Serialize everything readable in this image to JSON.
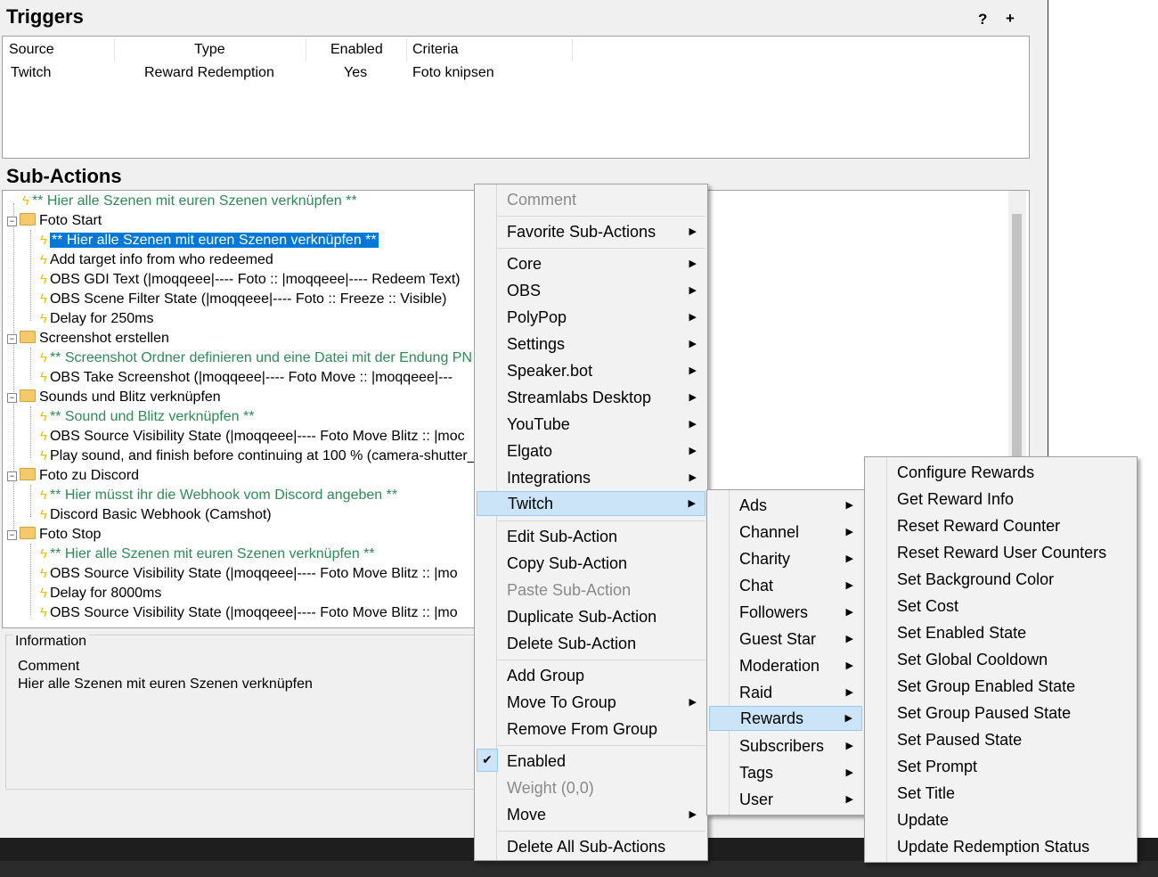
{
  "triggers": {
    "title": "Triggers",
    "help_icon": "?",
    "add_icon": "+",
    "columns": [
      "Source",
      "Type",
      "Enabled",
      "Criteria"
    ],
    "rows": [
      {
        "source": "Twitch",
        "type": "Reward Redemption",
        "enabled": "Yes",
        "criteria": "Foto knipsen"
      }
    ]
  },
  "subactions": {
    "title": "Sub-Actions",
    "items": [
      "** Hier alle Szenen mit euren Szenen verknüpfen **",
      "Foto Start",
      "** Hier alle Szenen mit euren Szenen verknüpfen **",
      "Add target info from who redeemed",
      "OBS GDI Text (‬|moqqeee|---- Foto :: |moqqeee|---- Redeem Text)",
      "OBS Scene Filter State (‬|moqqeee|---- Foto :: Freeze :: Visible)",
      "Delay for 250ms",
      "Screenshot erstellen",
      "** Screenshot Ordner definieren und eine Datei mit der Endung PN",
      "OBS Take Screenshot (‬|moqqeee|---- Foto Move :: ‬|moqqeee|---",
      "Sounds und Blitz verknüpfen",
      "** Sound und Blitz verknüpfen **",
      "OBS Source Visibility State (‬|moqqeee|---- Foto Move Blitz :: |moc",
      "Play sound, and finish before continuing at 100 % (camera-shutter_",
      "Foto zu Discord",
      "** Hier müsst ihr die Webhook vom Discord angeben **",
      "Discord Basic Webhook (Camshot)",
      "Foto Stop",
      "** Hier alle Szenen mit euren Szenen verknüpfen **",
      "OBS Source Visibility State (‬|moqqeee|---- Foto Move Blitz :: ‬|mo",
      "Delay for 8000ms",
      "OBS Source Visibility State (‬|moqqeee|---- Foto Move Blitz :: ‬|mo"
    ]
  },
  "information": {
    "legend": "Information",
    "label": "Comment",
    "value": "Hier alle Szenen mit euren Szenen verknüpfen"
  },
  "context_menu": {
    "comment": "Comment",
    "favorites": "Favorite Sub-Actions",
    "core": "Core",
    "obs": "OBS",
    "polypop": "PolyPop",
    "settings": "Settings",
    "speakerbot": "Speaker.bot",
    "streamlabs": "Streamlabs Desktop",
    "youtube": "YouTube",
    "elgato": "Elgato",
    "integrations": "Integrations",
    "twitch": "Twitch",
    "edit": "Edit Sub-Action",
    "copy": "Copy Sub-Action",
    "paste": "Paste Sub-Action",
    "duplicate": "Duplicate Sub-Action",
    "delete": "Delete Sub-Action",
    "add_group": "Add Group",
    "move_to_group": "Move To Group",
    "remove_from_group": "Remove From Group",
    "enabled": "Enabled",
    "weight": "Weight (0,0)",
    "move": "Move",
    "delete_all": "Delete All Sub-Actions"
  },
  "twitch_menu": [
    "Ads",
    "Channel",
    "Charity",
    "Chat",
    "Followers",
    "Guest Star",
    "Moderation",
    "Raid",
    "Rewards",
    "Subscribers",
    "Tags",
    "User"
  ],
  "rewards_menu": [
    "Configure Rewards",
    "Get Reward Info",
    "Reset Reward Counter",
    "Reset Reward User Counters",
    "Set Background Color",
    "Set Cost",
    "Set Enabled State",
    "Set Global Cooldown",
    "Set Group Enabled State",
    "Set Group Paused State",
    "Set Paused State",
    "Set Prompt",
    "Set Title",
    "Update",
    "Update Redemption Status"
  ],
  "glyphs": {
    "arrow": "▶",
    "check": "✔",
    "expander": "−",
    "bolt": "ϟ"
  },
  "colors": {
    "selection": "#0078d7",
    "comment_green": "#2e8b57",
    "menu_highlight": "#cce4f7"
  }
}
